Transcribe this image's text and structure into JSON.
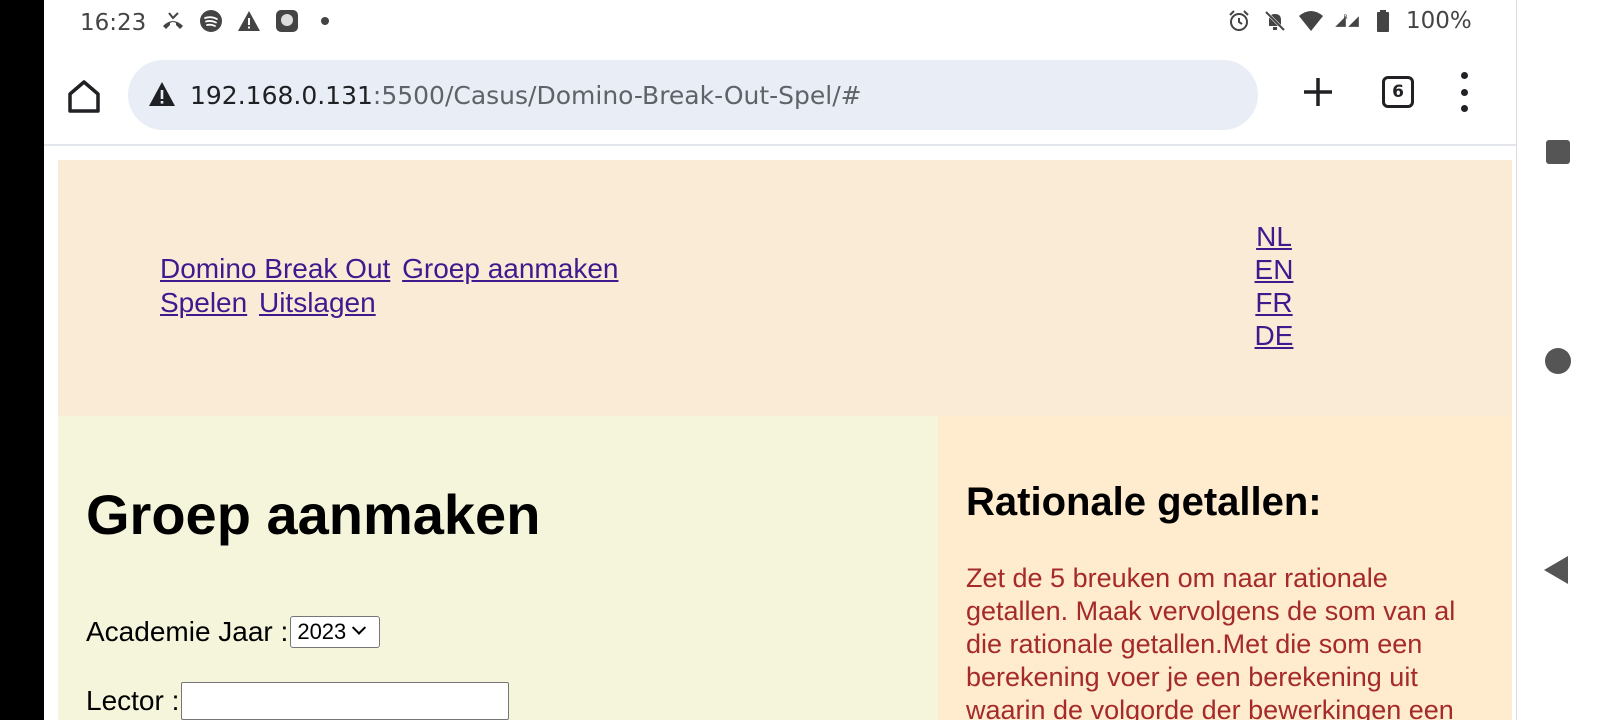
{
  "status_bar": {
    "time": "16:23",
    "left_icons": [
      "missed-call-icon",
      "spotify-icon",
      "warning-icon",
      "app-icon",
      "dot-icon"
    ],
    "right_icons": [
      "alarm-icon",
      "mute-icon",
      "wifi-icon",
      "signal-icon",
      "battery-icon"
    ],
    "battery_percent": "100%"
  },
  "browser": {
    "url_host": "192.168.0.131",
    "url_path": ":5500/Casus/Domino-Break-Out-Spel/#",
    "tab_count": "6"
  },
  "site": {
    "nav": [
      {
        "label": "Domino Break Out"
      },
      {
        "label": "Groep aanmaken"
      },
      {
        "label": "Spelen"
      },
      {
        "label": "Uitslagen"
      }
    ],
    "languages": [
      "NL",
      "EN",
      "FR",
      "DE"
    ]
  },
  "form": {
    "title": "Groep aanmaken",
    "year_label": "Academie Jaar :",
    "year_value": "2023",
    "lector_label": "Lector :",
    "lector_value": ""
  },
  "info": {
    "title": "Rationale getallen:",
    "text": "Zet de 5 breuken om naar rationale getallen. Maak vervolgens de som van al die rationale getallen.Met die som een berekening voer je een berekening uit waarin de volgorde der bewerkingen een"
  },
  "colors": {
    "header_bg": "#faebd7",
    "form_bg": "#f5f5dc",
    "info_bg": "#ffebcd",
    "link": "#3e1a8e",
    "info_text": "#a52a2a"
  }
}
